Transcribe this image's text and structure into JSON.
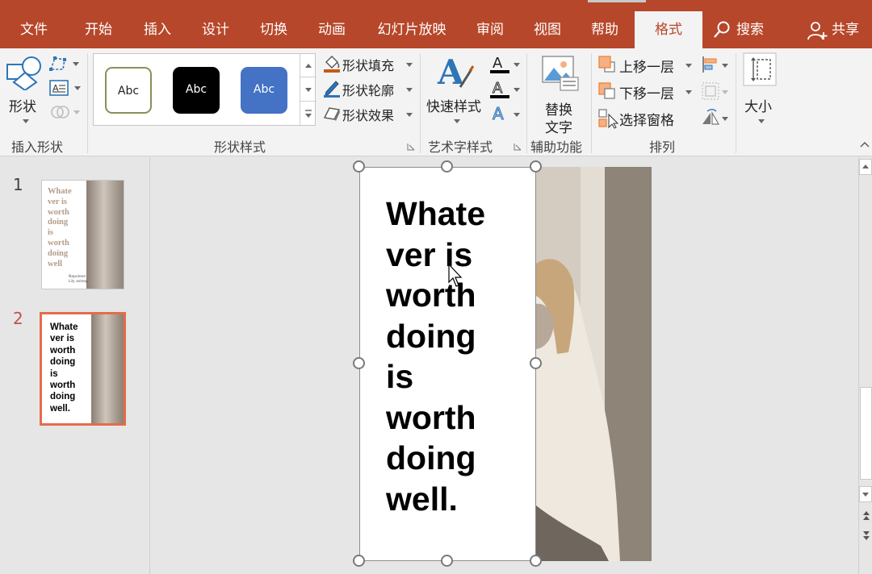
{
  "tabs": [
    {
      "label": "文件"
    },
    {
      "label": "开始"
    },
    {
      "label": "插入"
    },
    {
      "label": "设计"
    },
    {
      "label": "切换"
    },
    {
      "label": "动画"
    },
    {
      "label": "幻灯片放映"
    },
    {
      "label": "审阅"
    },
    {
      "label": "视图"
    },
    {
      "label": "帮助"
    },
    {
      "label": "格式",
      "active": true
    }
  ],
  "search_label": "搜索",
  "share_label": "共享",
  "ribbon": {
    "insert_shapes": {
      "shapes_label": "形状",
      "group_label": "插入形状"
    },
    "shape_styles": {
      "gallery": [
        {
          "label": "Abc",
          "style": "outline-olive"
        },
        {
          "label": "Abc",
          "style": "black"
        },
        {
          "label": "Abc",
          "style": "blue"
        }
      ],
      "fill_label": "形状填充",
      "outline_label": "形状轮廓",
      "effects_label": "形状效果",
      "group_label": "形状样式"
    },
    "wordart": {
      "quick_styles_label": "快速样式",
      "group_label": "艺术字样式"
    },
    "accessibility": {
      "alt_text_line1": "替换",
      "alt_text_line2": "文字",
      "group_label": "辅助功能"
    },
    "arrange": {
      "bring_forward_label": "上移一层",
      "send_backward_label": "下移一层",
      "selection_pane_label": "选择窗格",
      "group_label": "排列"
    },
    "size": {
      "size_label": "大小"
    }
  },
  "slides_panel": {
    "slides": [
      {
        "number": "1",
        "text_lines": [
          "Whate",
          "ver is",
          "worth",
          "doing",
          "is",
          "worth",
          "doing",
          "well"
        ],
        "caption_lines": [
          "Napoleon",
          "Lily asleep"
        ]
      },
      {
        "number": "2",
        "selected": true,
        "text_lines": [
          "Whate",
          "ver is",
          "worth",
          "doing",
          "is",
          "worth",
          "doing",
          "well."
        ]
      }
    ]
  },
  "canvas": {
    "text_lines": [
      "Whate",
      "ver is",
      "worth",
      "doing",
      "is",
      "worth",
      "doing",
      "well."
    ]
  },
  "colors": {
    "accent": "#b7472a",
    "ribbon_bg": "#f3f3f3",
    "selected_thumb_border": "#e46c4c",
    "blue_style": "#4472c4"
  }
}
